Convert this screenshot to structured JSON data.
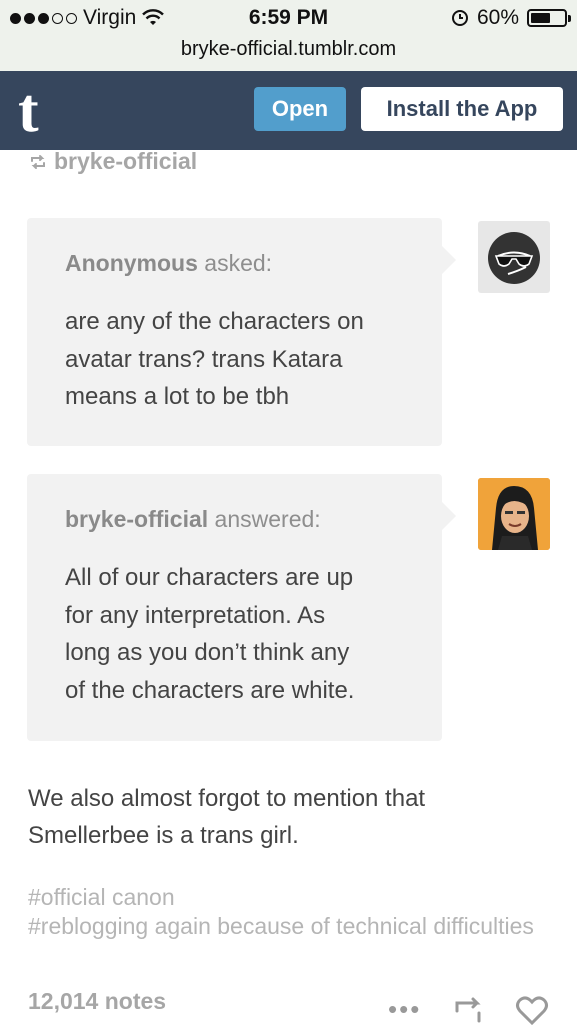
{
  "status_bar": {
    "carrier": "Virgin",
    "time": "6:59 PM",
    "battery": "60%",
    "battery_level": 0.6,
    "url": "bryke-official.tumblr.com"
  },
  "tumblr_bar": {
    "logo": "t",
    "open_label": "Open",
    "install_label": "Install the App"
  },
  "post": {
    "reblogged_from": "bryke-official",
    "question": {
      "asker": "Anonymous",
      "verb": "asked:",
      "lines": [
        "are any of the characters on",
        "avatar trans? trans Katara",
        "means a lot to be tbh"
      ]
    },
    "answer": {
      "answerer": "bryke-official",
      "verb": "answered:",
      "lines": [
        "All of our characters are up",
        "for any interpretation. As",
        "long as you don’t think any",
        "of the characters are white."
      ]
    },
    "body_lines": [
      "We also almost forgot to mention that",
      "Smellerbee is a trans girl."
    ],
    "tags": [
      "#official canon",
      "#reblogging again because of technical difficulties"
    ],
    "notes": "12,014 notes",
    "more_label": "•••"
  },
  "icons": [
    "wifi-icon",
    "alarm-icon",
    "battery-icon",
    "reblog-icon",
    "more-icon",
    "heart-icon"
  ]
}
